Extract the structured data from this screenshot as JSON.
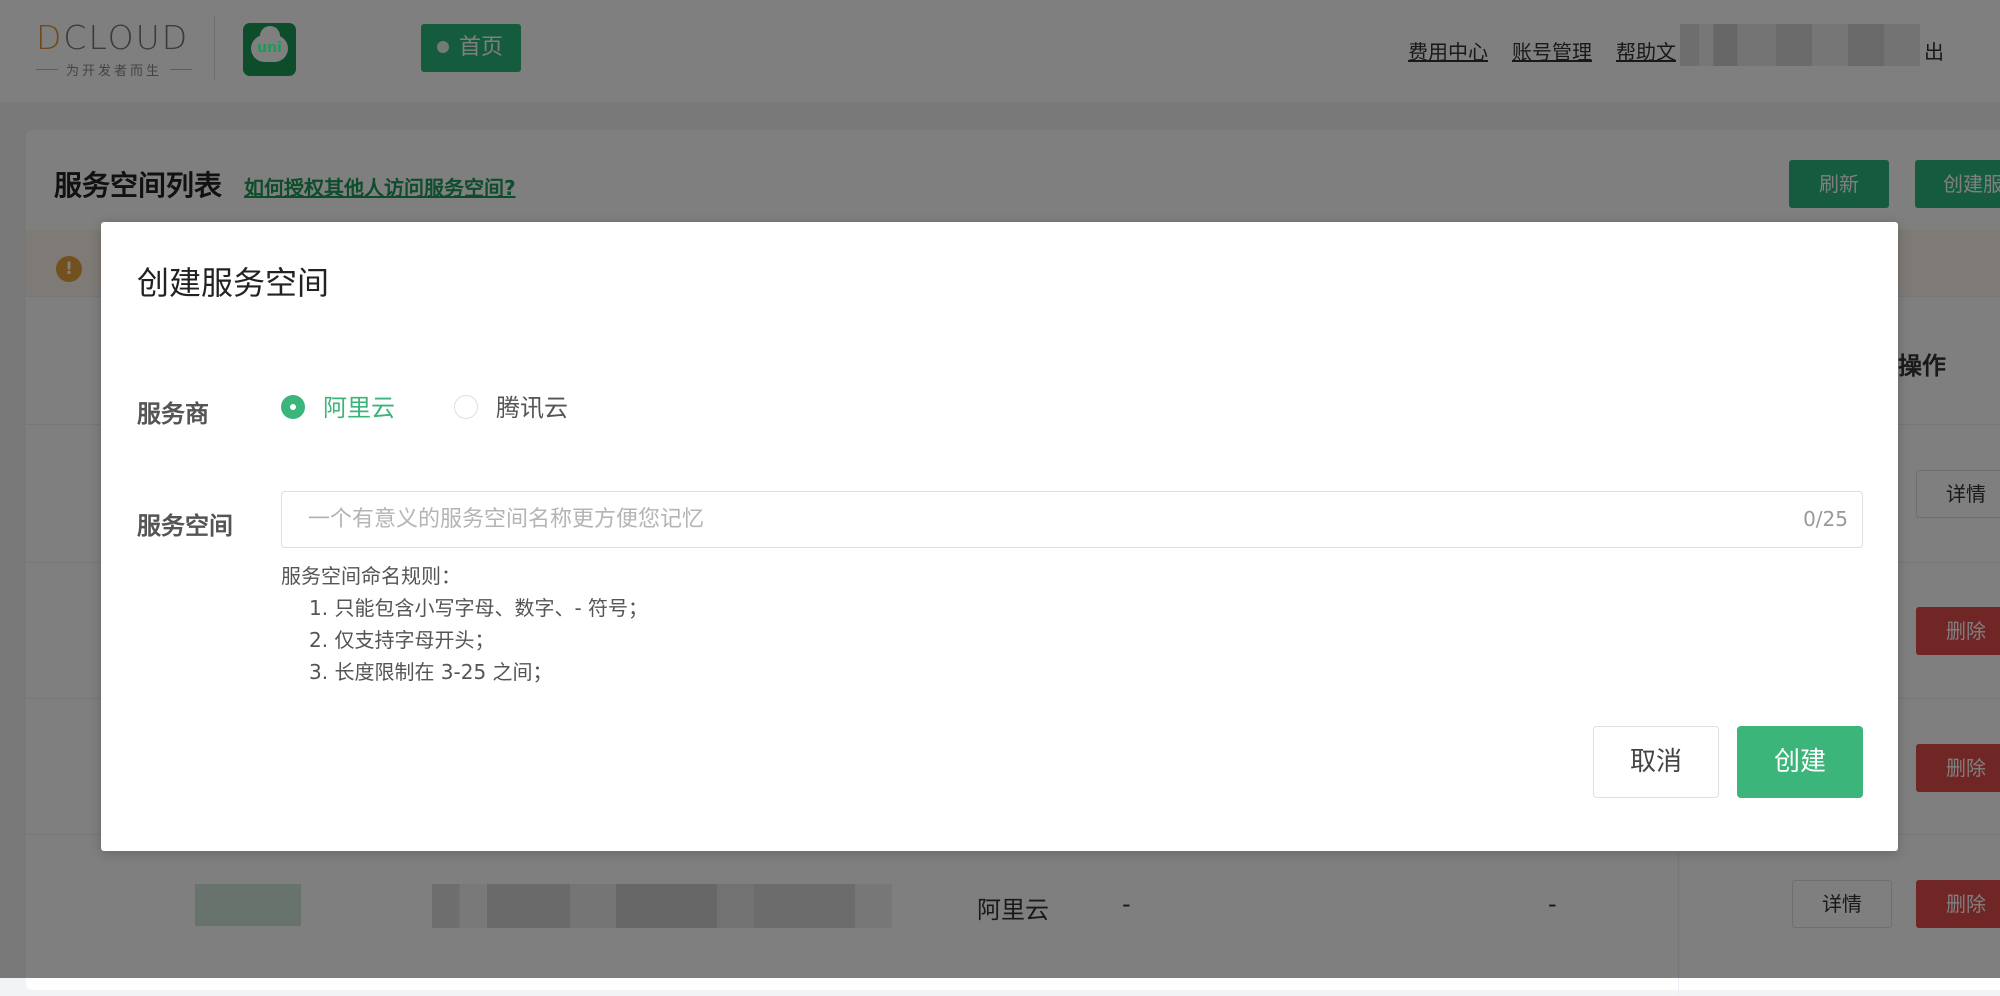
{
  "header": {
    "logo_text": "DCLOUD",
    "logo_tagline": "为开发者而生",
    "uni_logo_text": "uni",
    "home_label": "首页",
    "links": [
      "费用中心",
      "账号管理",
      "帮助文"
    ],
    "logout_label": "出"
  },
  "page": {
    "title": "服务空间列表",
    "auth_link": "如何授权其他人访问服务空间?",
    "refresh_label": "刷新",
    "create_label": "创建服",
    "warning_icon": "!",
    "operation_column": "操作",
    "detail_label": "详情",
    "delete_label": "删除",
    "last_row": {
      "provider": "阿里云",
      "col_a": "-",
      "col_b": "-"
    }
  },
  "modal": {
    "title": "创建服务空间",
    "provider_label": "服务商",
    "providers": [
      {
        "label": "阿里云",
        "checked": true
      },
      {
        "label": "腾讯云",
        "checked": false
      }
    ],
    "space_label": "服务空间",
    "input_value": "",
    "input_placeholder": "一个有意义的服务空间名称更方便您记忆",
    "counter": "0/25",
    "rules_title": "服务空间命名规则：",
    "rules": [
      "1. 只能包含小写字母、数字、- 符号；",
      "2. 仅支持字母开头；",
      "3. 长度限制在 3-25 之间；"
    ],
    "cancel_label": "取消",
    "confirm_label": "创建"
  },
  "colors": {
    "brand_green": "#2bb77a",
    "radio_green": "#3bb57a",
    "danger_red": "#e34d4d",
    "warning_orange": "#e6a23c"
  }
}
